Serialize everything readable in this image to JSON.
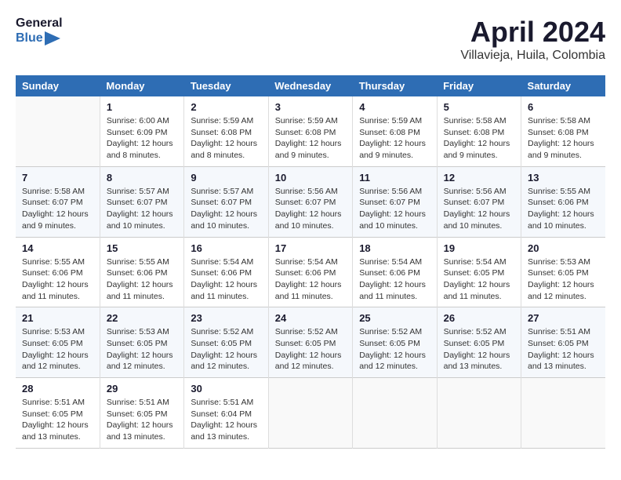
{
  "header": {
    "logo_line1": "General",
    "logo_line2": "Blue",
    "title": "April 2024",
    "subtitle": "Villavieja, Huila, Colombia"
  },
  "columns": [
    "Sunday",
    "Monday",
    "Tuesday",
    "Wednesday",
    "Thursday",
    "Friday",
    "Saturday"
  ],
  "weeks": [
    [
      {
        "day": "",
        "sunrise": "",
        "sunset": "",
        "daylight": ""
      },
      {
        "day": "1",
        "sunrise": "Sunrise: 6:00 AM",
        "sunset": "Sunset: 6:09 PM",
        "daylight": "Daylight: 12 hours and 8 minutes."
      },
      {
        "day": "2",
        "sunrise": "Sunrise: 5:59 AM",
        "sunset": "Sunset: 6:08 PM",
        "daylight": "Daylight: 12 hours and 8 minutes."
      },
      {
        "day": "3",
        "sunrise": "Sunrise: 5:59 AM",
        "sunset": "Sunset: 6:08 PM",
        "daylight": "Daylight: 12 hours and 9 minutes."
      },
      {
        "day": "4",
        "sunrise": "Sunrise: 5:59 AM",
        "sunset": "Sunset: 6:08 PM",
        "daylight": "Daylight: 12 hours and 9 minutes."
      },
      {
        "day": "5",
        "sunrise": "Sunrise: 5:58 AM",
        "sunset": "Sunset: 6:08 PM",
        "daylight": "Daylight: 12 hours and 9 minutes."
      },
      {
        "day": "6",
        "sunrise": "Sunrise: 5:58 AM",
        "sunset": "Sunset: 6:08 PM",
        "daylight": "Daylight: 12 hours and 9 minutes."
      }
    ],
    [
      {
        "day": "7",
        "sunrise": "Sunrise: 5:58 AM",
        "sunset": "Sunset: 6:07 PM",
        "daylight": "Daylight: 12 hours and 9 minutes."
      },
      {
        "day": "8",
        "sunrise": "Sunrise: 5:57 AM",
        "sunset": "Sunset: 6:07 PM",
        "daylight": "Daylight: 12 hours and 10 minutes."
      },
      {
        "day": "9",
        "sunrise": "Sunrise: 5:57 AM",
        "sunset": "Sunset: 6:07 PM",
        "daylight": "Daylight: 12 hours and 10 minutes."
      },
      {
        "day": "10",
        "sunrise": "Sunrise: 5:56 AM",
        "sunset": "Sunset: 6:07 PM",
        "daylight": "Daylight: 12 hours and 10 minutes."
      },
      {
        "day": "11",
        "sunrise": "Sunrise: 5:56 AM",
        "sunset": "Sunset: 6:07 PM",
        "daylight": "Daylight: 12 hours and 10 minutes."
      },
      {
        "day": "12",
        "sunrise": "Sunrise: 5:56 AM",
        "sunset": "Sunset: 6:07 PM",
        "daylight": "Daylight: 12 hours and 10 minutes."
      },
      {
        "day": "13",
        "sunrise": "Sunrise: 5:55 AM",
        "sunset": "Sunset: 6:06 PM",
        "daylight": "Daylight: 12 hours and 10 minutes."
      }
    ],
    [
      {
        "day": "14",
        "sunrise": "Sunrise: 5:55 AM",
        "sunset": "Sunset: 6:06 PM",
        "daylight": "Daylight: 12 hours and 11 minutes."
      },
      {
        "day": "15",
        "sunrise": "Sunrise: 5:55 AM",
        "sunset": "Sunset: 6:06 PM",
        "daylight": "Daylight: 12 hours and 11 minutes."
      },
      {
        "day": "16",
        "sunrise": "Sunrise: 5:54 AM",
        "sunset": "Sunset: 6:06 PM",
        "daylight": "Daylight: 12 hours and 11 minutes."
      },
      {
        "day": "17",
        "sunrise": "Sunrise: 5:54 AM",
        "sunset": "Sunset: 6:06 PM",
        "daylight": "Daylight: 12 hours and 11 minutes."
      },
      {
        "day": "18",
        "sunrise": "Sunrise: 5:54 AM",
        "sunset": "Sunset: 6:06 PM",
        "daylight": "Daylight: 12 hours and 11 minutes."
      },
      {
        "day": "19",
        "sunrise": "Sunrise: 5:54 AM",
        "sunset": "Sunset: 6:05 PM",
        "daylight": "Daylight: 12 hours and 11 minutes."
      },
      {
        "day": "20",
        "sunrise": "Sunrise: 5:53 AM",
        "sunset": "Sunset: 6:05 PM",
        "daylight": "Daylight: 12 hours and 12 minutes."
      }
    ],
    [
      {
        "day": "21",
        "sunrise": "Sunrise: 5:53 AM",
        "sunset": "Sunset: 6:05 PM",
        "daylight": "Daylight: 12 hours and 12 minutes."
      },
      {
        "day": "22",
        "sunrise": "Sunrise: 5:53 AM",
        "sunset": "Sunset: 6:05 PM",
        "daylight": "Daylight: 12 hours and 12 minutes."
      },
      {
        "day": "23",
        "sunrise": "Sunrise: 5:52 AM",
        "sunset": "Sunset: 6:05 PM",
        "daylight": "Daylight: 12 hours and 12 minutes."
      },
      {
        "day": "24",
        "sunrise": "Sunrise: 5:52 AM",
        "sunset": "Sunset: 6:05 PM",
        "daylight": "Daylight: 12 hours and 12 minutes."
      },
      {
        "day": "25",
        "sunrise": "Sunrise: 5:52 AM",
        "sunset": "Sunset: 6:05 PM",
        "daylight": "Daylight: 12 hours and 12 minutes."
      },
      {
        "day": "26",
        "sunrise": "Sunrise: 5:52 AM",
        "sunset": "Sunset: 6:05 PM",
        "daylight": "Daylight: 12 hours and 13 minutes."
      },
      {
        "day": "27",
        "sunrise": "Sunrise: 5:51 AM",
        "sunset": "Sunset: 6:05 PM",
        "daylight": "Daylight: 12 hours and 13 minutes."
      }
    ],
    [
      {
        "day": "28",
        "sunrise": "Sunrise: 5:51 AM",
        "sunset": "Sunset: 6:05 PM",
        "daylight": "Daylight: 12 hours and 13 minutes."
      },
      {
        "day": "29",
        "sunrise": "Sunrise: 5:51 AM",
        "sunset": "Sunset: 6:05 PM",
        "daylight": "Daylight: 12 hours and 13 minutes."
      },
      {
        "day": "30",
        "sunrise": "Sunrise: 5:51 AM",
        "sunset": "Sunset: 6:04 PM",
        "daylight": "Daylight: 12 hours and 13 minutes."
      },
      {
        "day": "",
        "sunrise": "",
        "sunset": "",
        "daylight": ""
      },
      {
        "day": "",
        "sunrise": "",
        "sunset": "",
        "daylight": ""
      },
      {
        "day": "",
        "sunrise": "",
        "sunset": "",
        "daylight": ""
      },
      {
        "day": "",
        "sunrise": "",
        "sunset": "",
        "daylight": ""
      }
    ]
  ]
}
